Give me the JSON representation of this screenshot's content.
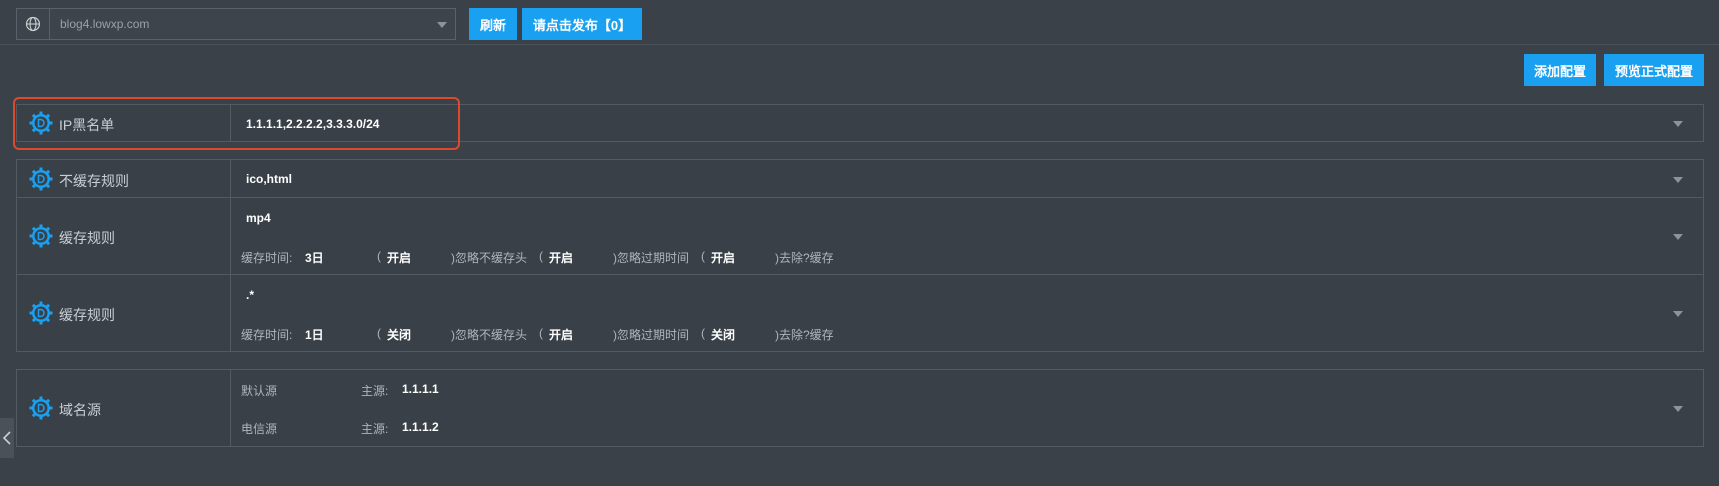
{
  "topbar": {
    "domain": "blog4.lowxp.com",
    "refresh_label": "刷新",
    "publish_label": "请点击发布【0】"
  },
  "actions": {
    "add_config_label": "添加配置",
    "preview_label": "预览正式配置"
  },
  "rows": {
    "ip_blacklist": {
      "label": "IP黑名单",
      "value": "1.1.1.1,2.2.2.2,3.3.3.0/24"
    },
    "no_cache": {
      "label": "不缓存规则",
      "value": "ico,html"
    },
    "cache1": {
      "label": "缓存规则",
      "value": "mp4",
      "time_label": "缓存时间:",
      "time": "3日",
      "open1": "(",
      "v1": "开启",
      "t1": ")忽略不缓存头",
      "open2": "(",
      "v2": "开启",
      "t2": ")忽略过期时间",
      "open3": "(",
      "v3": "开启",
      "t3": ")去除?缓存"
    },
    "cache2": {
      "label": "缓存规则",
      "value": ".*",
      "time_label": "缓存时间:",
      "time": "1日",
      "open1": "(",
      "v1": "关闭",
      "t1": ")忽略不缓存头",
      "open2": "(",
      "v2": "开启",
      "t2": ")忽略过期时间",
      "open3": "(",
      "v3": "关闭",
      "t3": ")去除?缓存"
    },
    "origin": {
      "label": "域名源",
      "sources": [
        {
          "name": "默认源",
          "main_label": "主源:",
          "ip": "1.1.1.1"
        },
        {
          "name": "电信源",
          "main_label": "主源:",
          "ip": "1.1.1.2"
        }
      ]
    }
  },
  "icons": {
    "globe": "globe-icon",
    "gear": "gear-d-icon",
    "chevron": "chevron-left-icon"
  },
  "colors": {
    "accent": "#1aa0f0",
    "highlight": "#e0482e",
    "background": "#3a4148"
  }
}
